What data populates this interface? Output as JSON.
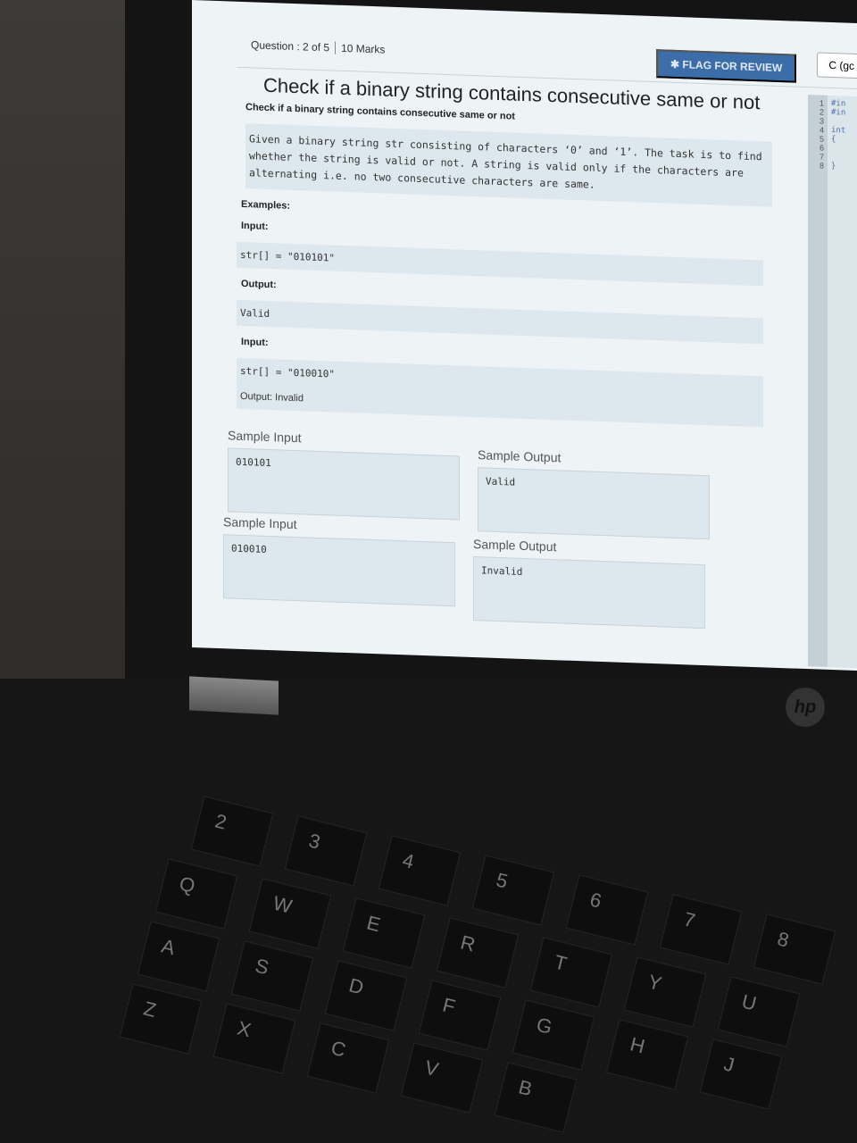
{
  "header": {
    "question": "Question : 2 of 5",
    "marks": "10 Marks",
    "flag_label": "FLAG FOR REVIEW",
    "language": "C (gc"
  },
  "problem": {
    "title": "Check if a binary string contains consecutive same or not",
    "subtitle": "Check if a binary string contains consecutive same or not",
    "description": "Given a binary string str consisting of characters ‘0’ and ‘1’. The task is to find whether the string is valid or not. A string is valid only if the characters are alternating i.e. no two consecutive characters are same.",
    "examples_label": "Examples:",
    "input_label": "Input:",
    "output_label": "Output:",
    "input1": "str[] = \"010101\"",
    "output1": "Valid",
    "input2": "str[] = \"010010\"",
    "output2_line": "Output: Invalid"
  },
  "samples": [
    {
      "input_title": "Sample Input",
      "input": "010101",
      "output_title": "Sample Output",
      "output": "Valid"
    },
    {
      "input_title": "Sample Input",
      "input": "010010",
      "output_title": "Sample Output",
      "output": "Invalid"
    }
  ],
  "editor": {
    "line_numbers": "1\n2\n3\n4\n5\n6\n7\n8",
    "code": "#in\n#in\n\nint\n{\n\n\n}"
  },
  "laptop": {
    "logo": "hp",
    "keys": [
      "Q",
      "W",
      "E",
      "R",
      "T",
      "Y",
      "U",
      "A",
      "S",
      "D",
      "F",
      "G",
      "H",
      "J",
      "Z",
      "X",
      "C",
      "V",
      "B",
      "2",
      "3",
      "4",
      "5",
      "6",
      "7",
      "8"
    ]
  }
}
